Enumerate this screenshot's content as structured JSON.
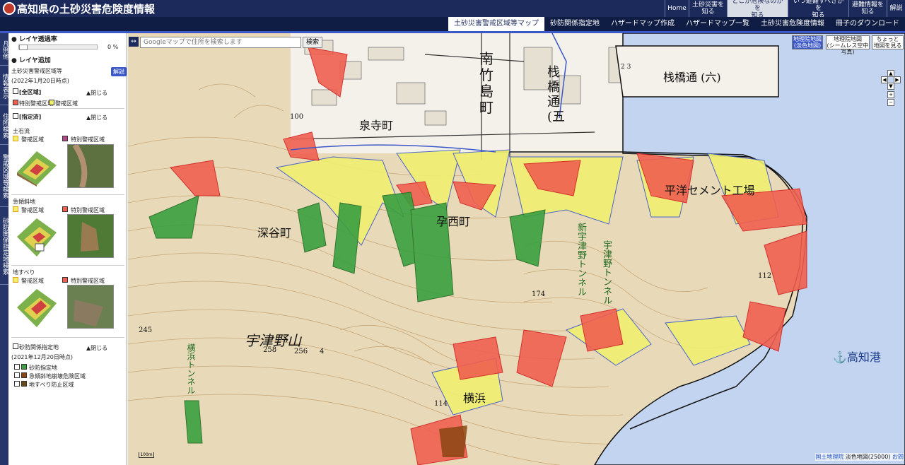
{
  "header": {
    "title": "高知県の土砂災害危険度情報",
    "nav": [
      {
        "label": "Home"
      },
      {
        "label": "土砂災害を\n知る"
      },
      {
        "label": "どこが危険なのかを\n知る",
        "active": true
      },
      {
        "label": "いつ避難すべきかを\n知る"
      },
      {
        "label": "避難情報を\n知る"
      },
      {
        "label": "解説"
      }
    ]
  },
  "subnav": [
    {
      "label": "土砂災害警戒区域等マップ",
      "active": true
    },
    {
      "label": "砂防関係指定地"
    },
    {
      "label": "ハザードマップ作成"
    },
    {
      "label": "ハザードマップ一覧"
    },
    {
      "label": "土砂災害危険度情報"
    },
    {
      "label": "冊子のダウンロード"
    }
  ],
  "vtabs": [
    "凡例他",
    "情報表示",
    "住所検索",
    "警戒区域等検索",
    "砂防関係指定地検索"
  ],
  "panel": {
    "opacity_title": "レイヤ透過率",
    "opacity_value": "0 %",
    "opacity_fraction": 0,
    "add_title": "レイヤ追加",
    "zone_title": "土砂災害警戒区域等",
    "zone_date": "(2022年1月20日時点)",
    "explain": "解説",
    "all_zone": "[全区域]",
    "close": "▲閉じる",
    "special_label": "特別警戒区域",
    "warning_label": "警戒区域",
    "designated": "[指定済]",
    "debris": "土石流",
    "slope": "急傾斜地",
    "landslide": "地すべり",
    "sabo_title": "砂防関係指定地",
    "sabo_date": "(2021年12月20日時点)",
    "sabo_items": [
      "砂防指定地",
      "急傾斜地崩壊危険区域",
      "地すべり防止区域"
    ]
  },
  "map": {
    "search_placeholder": "Googleマップで住所を検索します",
    "search_btn": "検索",
    "btn_basemap": "地理院地図\n(淡色地図)",
    "btn_photo": "地理院地図\n(シームレス空中写真)",
    "btn_area": "ちょっと\n地図を見る",
    "labels": {
      "minami": "南\n竹\n島\n町",
      "sanbashi": "栈\n橋\n通\n(五",
      "sanbashi6": "栈橋通 (六)",
      "izumiji": "泉寺町",
      "fukaya": "深谷町",
      "yuzhi": "孕西町",
      "cement": "平洋セメント工場",
      "unoyama": "宇津野山",
      "kochiko": "高知港",
      "tunnel1": "新宇津野トンネル",
      "tunnel2": "宇津野トンネル",
      "tunnel3": "横浜トンネル",
      "yoko": "横浜",
      "h100": "100",
      "h245": "245",
      "h258": "258",
      "h256": "256",
      "h174": "174",
      "h112": "112",
      "h114": "114",
      "h23": "2 3",
      "h4": "4"
    },
    "credit_src": "国土地理院",
    "credit_map": "淡色地図(25000)",
    "credit_link": "お問",
    "scale": "100m"
  },
  "colors": {
    "special": "#f06050",
    "warning": "#f0f070",
    "sabo": "#3aa040",
    "slope_zone": "#8b4513",
    "landslide_zone": "#6b4a1a",
    "sea": "#c2d4ef"
  }
}
